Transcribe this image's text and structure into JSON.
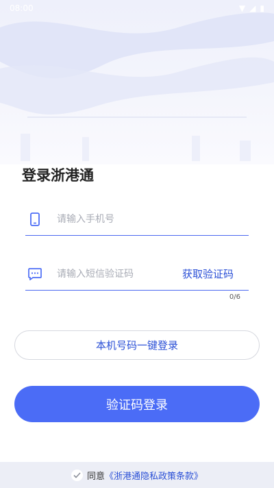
{
  "status_bar": {
    "time": "08:00"
  },
  "page": {
    "title": "登录浙港通"
  },
  "phone_field": {
    "placeholder": "请输入手机号",
    "value": ""
  },
  "code_field": {
    "placeholder": "请输入短信验证码",
    "value": "",
    "get_code_label": "获取验证码",
    "counter": "0/6"
  },
  "buttons": {
    "one_key_login": "本机号码一键登录",
    "code_login": "验证码登录"
  },
  "agreement": {
    "prefix": "同意",
    "link": "《浙港通隐私政策条款》"
  },
  "colors": {
    "accent": "#4b6cf6",
    "link": "#2a4fd6",
    "underline": "#4a67f0"
  }
}
